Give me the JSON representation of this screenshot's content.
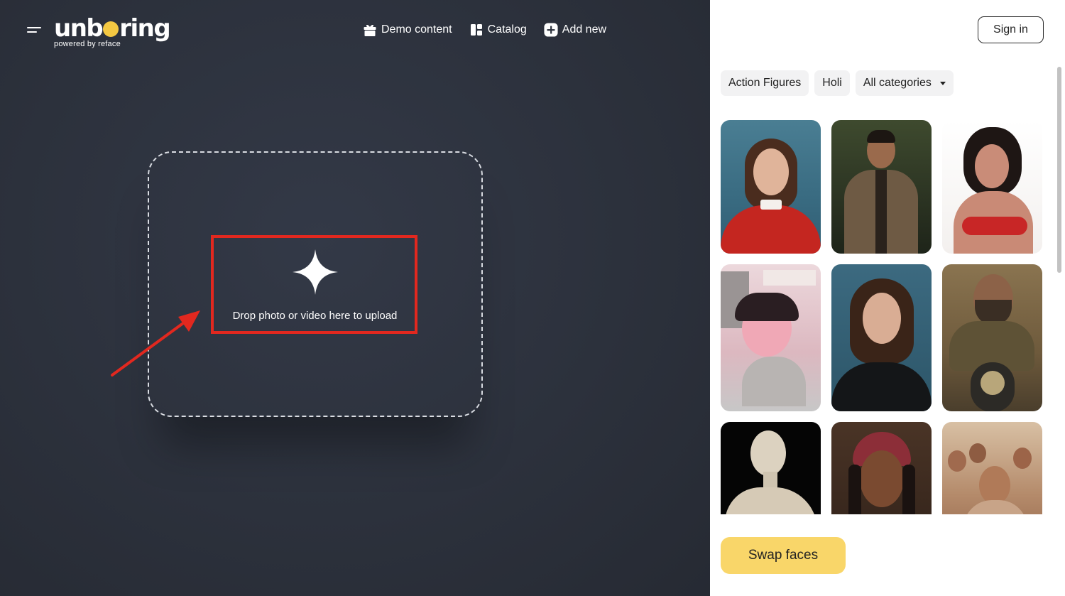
{
  "header": {
    "logo_text_pre": "unb",
    "logo_text_post": "ring",
    "logo_tagline": "powered by reface",
    "nav": [
      {
        "label": "Demo content",
        "icon": "gift-icon"
      },
      {
        "label": "Catalog",
        "icon": "catalog-icon"
      },
      {
        "label": "Add new",
        "icon": "plus-square-icon"
      }
    ]
  },
  "upload": {
    "label": "Drop photo or video here to upload",
    "highlight_color": "#e2281f"
  },
  "sidebar": {
    "sign_in": "Sign in",
    "chips": [
      "Action Figures",
      "Holi",
      "All categories"
    ],
    "swap_button": "Swap faces",
    "accent_color": "#f9d669"
  },
  "gallery": [
    {
      "name": "woman-red-sweater"
    },
    {
      "name": "man-embroidered-jacket"
    },
    {
      "name": "woman-red-bikini-painting"
    },
    {
      "name": "vintage-pinup-poster"
    },
    {
      "name": "woman-leather-jacket"
    },
    {
      "name": "man-motorcycle"
    },
    {
      "name": "marble-statue"
    },
    {
      "name": "woman-headscarf"
    },
    {
      "name": "holi-crowd"
    }
  ]
}
